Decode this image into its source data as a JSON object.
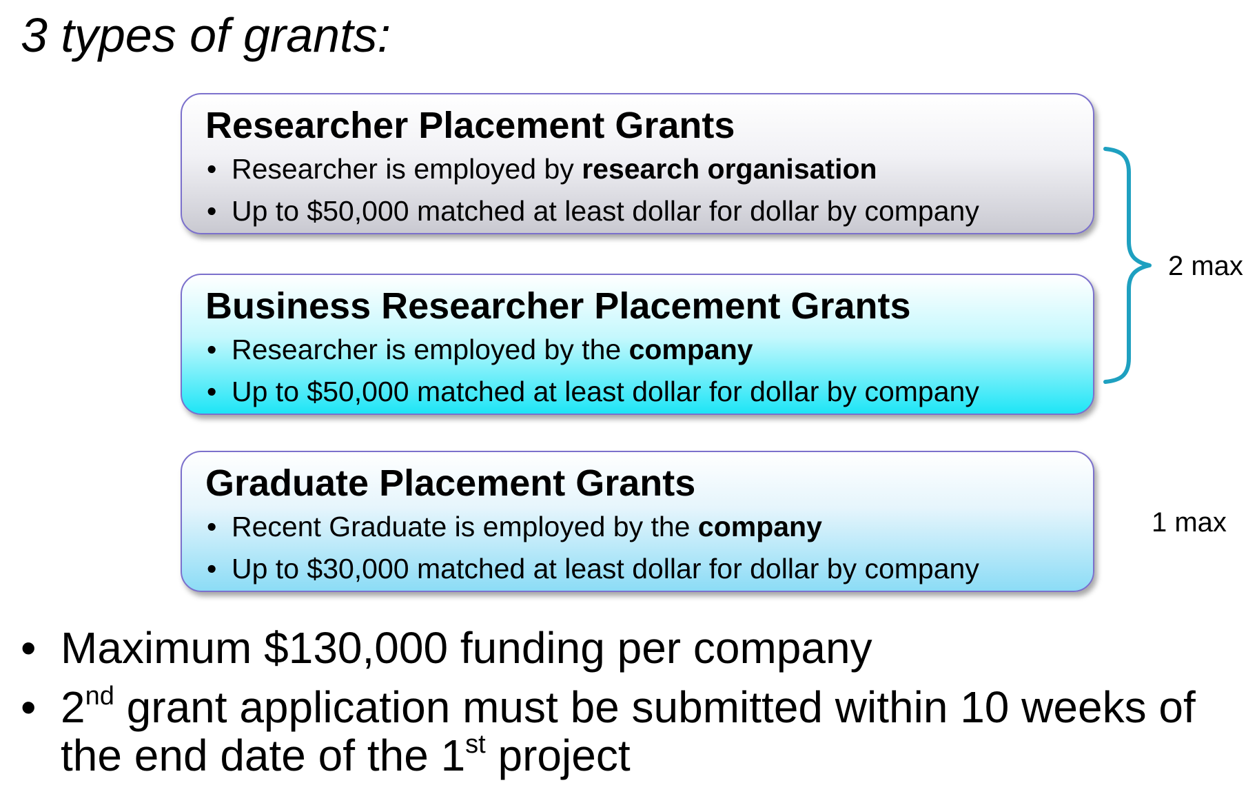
{
  "title": "3 types of grants:",
  "grants": [
    {
      "title": "Researcher Placement Grants",
      "bullet1": {
        "prefix": "Researcher is employed by ",
        "emphasis": "research organisation"
      },
      "bullet2": "Up to $50,000 matched at least dollar for dollar by company"
    },
    {
      "title": "Business Researcher Placement Grants",
      "bullet1": {
        "prefix": "Researcher is employed by the ",
        "emphasis": "company"
      },
      "bullet2": "Up to $50,000 matched at least dollar for dollar by company"
    },
    {
      "title": "Graduate Placement Grants",
      "bullet1": {
        "prefix": "Recent Graduate is employed by the ",
        "emphasis": "company"
      },
      "bullet2": "Up to $30,000 matched at least dollar for dollar by company"
    }
  ],
  "limits": {
    "first_two": "2 max",
    "third": "1 max"
  },
  "summary": {
    "item1": "Maximum $130,000 funding per company",
    "item2": {
      "part1_number": "2",
      "part1_sup": "nd",
      "part2": " grant application must be submitted within 10 weeks of the end date of the 1",
      "part2_sup": "st",
      "part3": " project"
    }
  },
  "colors": {
    "box_border": "#7b70cc",
    "box1_gradient_end": "#c9c9d1",
    "box2_gradient_end": "#1ee5f6",
    "box3_gradient_end": "#8cdcf6",
    "brace": "#1ea0c0"
  }
}
